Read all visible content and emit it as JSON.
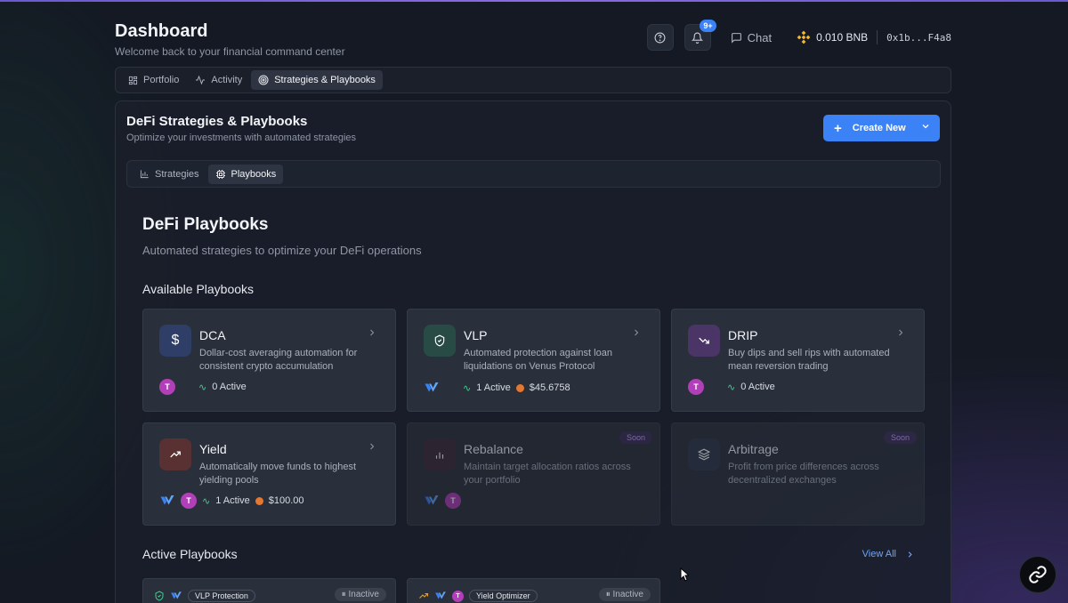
{
  "header": {
    "title": "Dashboard",
    "subtitle": "Welcome back to your financial command center",
    "notif_badge": "9+",
    "chat_label": "Chat",
    "balance": "0.010 BNB",
    "address": "0x1b...F4a8"
  },
  "main_tabs": [
    {
      "label": "Portfolio",
      "icon": "grid-icon"
    },
    {
      "label": "Activity",
      "icon": "activity-icon"
    },
    {
      "label": "Strategies & Playbooks",
      "icon": "target-icon",
      "active": true
    }
  ],
  "panel": {
    "title": "DeFi Strategies & Playbooks",
    "subtitle": "Optimize your investments with automated strategies",
    "create_label": "Create New"
  },
  "sub_tabs": [
    {
      "label": "Strategies",
      "icon": "bar-chart-icon"
    },
    {
      "label": "Playbooks",
      "icon": "cpu-icon",
      "active": true
    }
  ],
  "playbooks": {
    "title": "DeFi Playbooks",
    "subtitle": "Automated strategies to optimize your DeFi operations",
    "available_title": "Available Playbooks",
    "cards": [
      {
        "name": "DCA",
        "desc": "Dollar-cost averaging automation for consistent crypto accumulation",
        "active": "0 Active",
        "amount": "",
        "icon": "dollar-icon",
        "color": "#2f3e66"
      },
      {
        "name": "VLP",
        "desc": "Automated protection against loan liquidations on Venus Protocol",
        "active": "1 Active",
        "amount": "$45.6758",
        "icon": "shield-icon",
        "color": "#294b45"
      },
      {
        "name": "DRIP",
        "desc": "Buy dips and sell rips with automated mean reversion trading",
        "active": "0 Active",
        "amount": "",
        "icon": "trending-down-icon",
        "color": "#4a3566"
      },
      {
        "name": "Yield",
        "desc": "Automatically move funds to highest yielding pools",
        "active": "1 Active",
        "amount": "$100.00",
        "icon": "trending-up-icon",
        "color": "#5a3133"
      },
      {
        "name": "Rebalance",
        "desc": "Maintain target allocation ratios across your portfolio",
        "soon": "Soon",
        "icon": "bar-chart-icon",
        "color": "#3d2a38"
      },
      {
        "name": "Arbitrage",
        "desc": "Profit from price differences across decentralized exchanges",
        "soon": "Soon",
        "icon": "layers-icon",
        "color": "#2e3a4a"
      }
    ],
    "active_title": "Active Playbooks",
    "view_all": "View All",
    "active_cards": [
      {
        "name": "VLP Protection",
        "status": "Inactive"
      },
      {
        "name": "Yield Optimizer",
        "status": "Inactive"
      }
    ]
  }
}
